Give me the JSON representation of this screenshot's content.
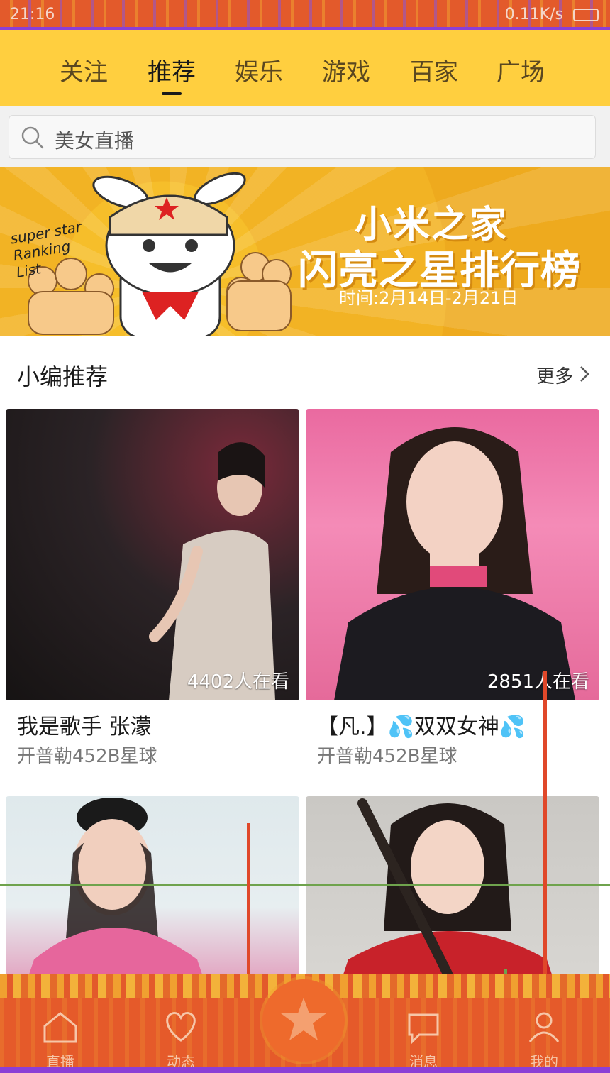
{
  "status_bar": {
    "time": "21:16",
    "network_speed": "0.11K/s"
  },
  "top_tabs": [
    {
      "label": "关注",
      "active": false
    },
    {
      "label": "推荐",
      "active": true
    },
    {
      "label": "娱乐",
      "active": false
    },
    {
      "label": "游戏",
      "active": false
    },
    {
      "label": "百家",
      "active": false
    },
    {
      "label": "广场",
      "active": false
    }
  ],
  "search": {
    "placeholder": "美女直播"
  },
  "banner": {
    "tag": "super star Ranking List",
    "title_line1": "小米之家",
    "title_line2": "闪亮之星排行榜",
    "date": "时间:2月14日-2月21日"
  },
  "section": {
    "title": "小编推荐",
    "more_label": "更多"
  },
  "cards": [
    {
      "viewers": "4402人在看",
      "title": "我是歌手 张濛",
      "subtitle": "开普勒452B星球"
    },
    {
      "viewers": "2851人在看",
      "title": "【凡.】💦双双女神💦",
      "subtitle": "开普勒452B星球"
    },
    {
      "viewers": "",
      "title": "",
      "subtitle": ""
    },
    {
      "viewers": "",
      "title": "",
      "subtitle": ""
    }
  ],
  "bottom_nav": [
    {
      "label": "直播",
      "icon": "home-icon"
    },
    {
      "label": "动态",
      "icon": "heart-icon"
    },
    {
      "label": "",
      "icon": "star-icon"
    },
    {
      "label": "消息",
      "icon": "chat-icon"
    },
    {
      "label": "我的",
      "icon": "user-icon"
    }
  ],
  "colors": {
    "accent_yellow": "#ffcf3f",
    "nav_orange": "#e55a2a"
  }
}
